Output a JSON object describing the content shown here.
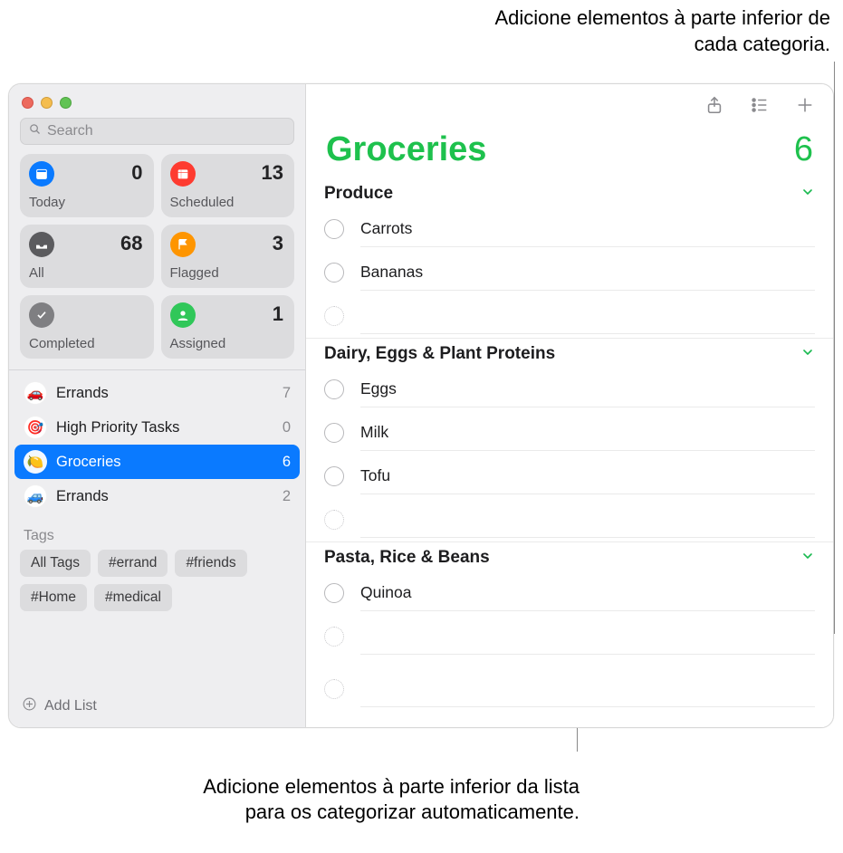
{
  "annotations": {
    "top": "Adicione elementos à parte inferior de cada categoria.",
    "bottom": "Adicione elementos à parte inferior da lista para os categorizar automaticamente."
  },
  "search": {
    "placeholder": "Search"
  },
  "cards": {
    "today": {
      "label": "Today",
      "count": "0"
    },
    "scheduled": {
      "label": "Scheduled",
      "count": "13"
    },
    "all": {
      "label": "All",
      "count": "68"
    },
    "flagged": {
      "label": "Flagged",
      "count": "3"
    },
    "completed": {
      "label": "Completed",
      "count": ""
    },
    "assigned": {
      "label": "Assigned",
      "count": "1"
    }
  },
  "lists": [
    {
      "emoji": "🚗",
      "name": "Errands",
      "count": "7",
      "active": false
    },
    {
      "emoji": "🎯",
      "name": "High Priority Tasks",
      "count": "0",
      "active": false
    },
    {
      "emoji": "🍋",
      "name": "Groceries",
      "count": "6",
      "active": true
    },
    {
      "emoji": "🚙",
      "name": "Errands",
      "count": "2",
      "active": false
    }
  ],
  "tags": {
    "header": "Tags",
    "items": [
      "All Tags",
      "#errand",
      "#friends",
      "#Home",
      "#medical"
    ]
  },
  "addList": "Add List",
  "main": {
    "title": "Groceries",
    "count": "6",
    "sections": [
      {
        "title": "Produce",
        "items": [
          "Carrots",
          "Bananas"
        ]
      },
      {
        "title": "Dairy, Eggs & Plant Proteins",
        "items": [
          "Eggs",
          "Milk",
          "Tofu"
        ]
      },
      {
        "title": "Pasta, Rice & Beans",
        "items": [
          "Quinoa"
        ]
      }
    ]
  }
}
